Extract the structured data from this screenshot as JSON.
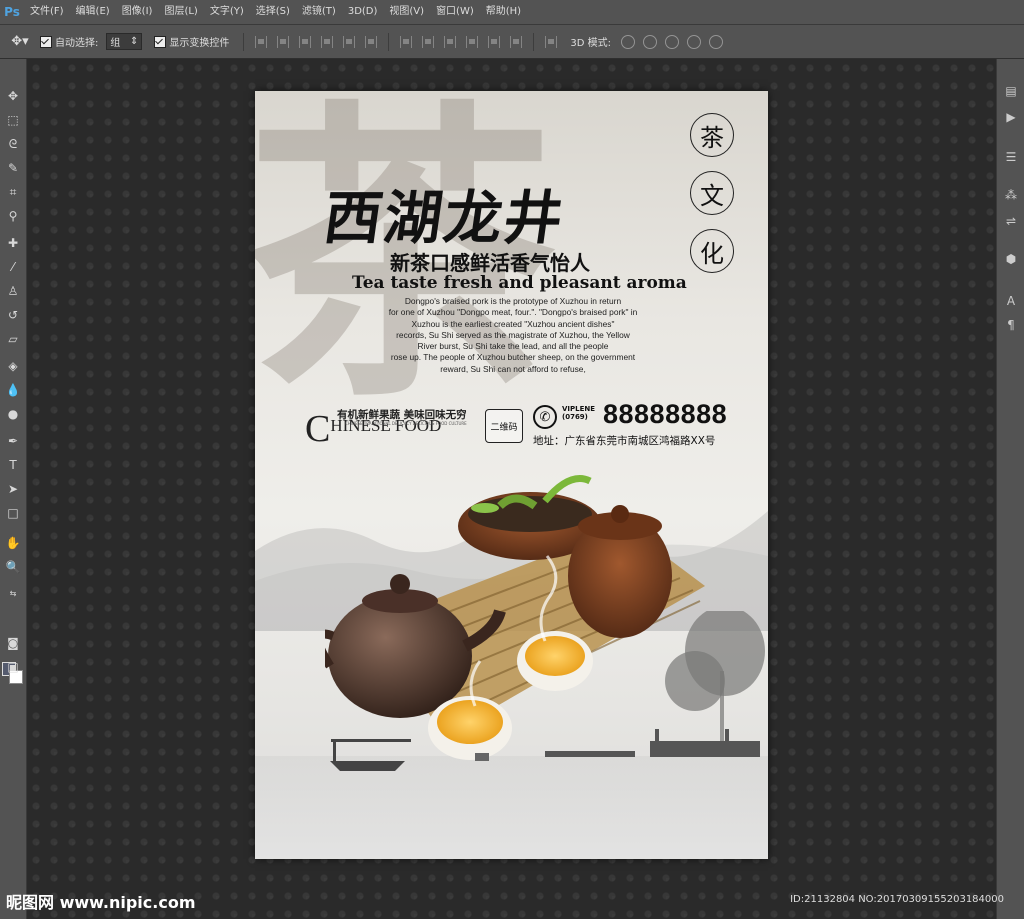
{
  "app": {
    "logo": "Ps"
  },
  "menu": [
    "文件(F)",
    "编辑(E)",
    "图像(I)",
    "图层(L)",
    "文字(Y)",
    "选择(S)",
    "滤镜(T)",
    "3D(D)",
    "视图(V)",
    "窗口(W)",
    "帮助(H)"
  ],
  "options_bar": {
    "auto_select_label": "自动选择:",
    "auto_select_value": "组",
    "show_transform_label": "显示变换控件",
    "mode_3d_label": "3D 模式:"
  },
  "poster": {
    "big_char": "茶",
    "title": "西湖龙井",
    "seal_chars": [
      "茶",
      "文",
      "化"
    ],
    "subtitle_cn": "新茶口感鲜活香气怡人",
    "subtitle_en": "Tea taste fresh and pleasant aroma",
    "body_lines": [
      "Dongpo's braised pork is the prototype of Xuzhou in return",
      "for one of Xuzhou \"Dongpo meat, four.\". \"Dongpo's braised pork\" in",
      "Xuzhou is the earliest created \"Xuzhou ancient dishes\"",
      "records, Su Shi served as the magistrate of Xuzhou, the Yellow",
      "River burst, Su Shi take the lead, and all the people",
      "rose up. The people of Xuzhou butcher sheep, on the government",
      "reward, Su Shi can not afford to refuse,"
    ],
    "slogan": "有机新鲜果蔬  美味回味无穷",
    "tiny_line": "CHINESE TRADITIONAL DELICACY DELICIOUS FOOD CULTURE",
    "chinese_food_initial": "C",
    "chinese_food_rest": "HINESE FOOD",
    "qr_label": "二维码",
    "phone_brand": "VIPLENE",
    "phone_area": "(0769)",
    "phone_number": "88888888",
    "address": "地址：广东省东莞市南城区鸿福路XX号"
  },
  "watermark": {
    "logo": "昵图网 www.nipic.com",
    "id": "ID:21132804 NO:20170309155203184000"
  },
  "colors": {
    "ui_gray": "#535353",
    "canvas_bg": "#2a2a2a",
    "fg_swatch": "#555b6e",
    "bg_swatch": "#ffffff"
  }
}
